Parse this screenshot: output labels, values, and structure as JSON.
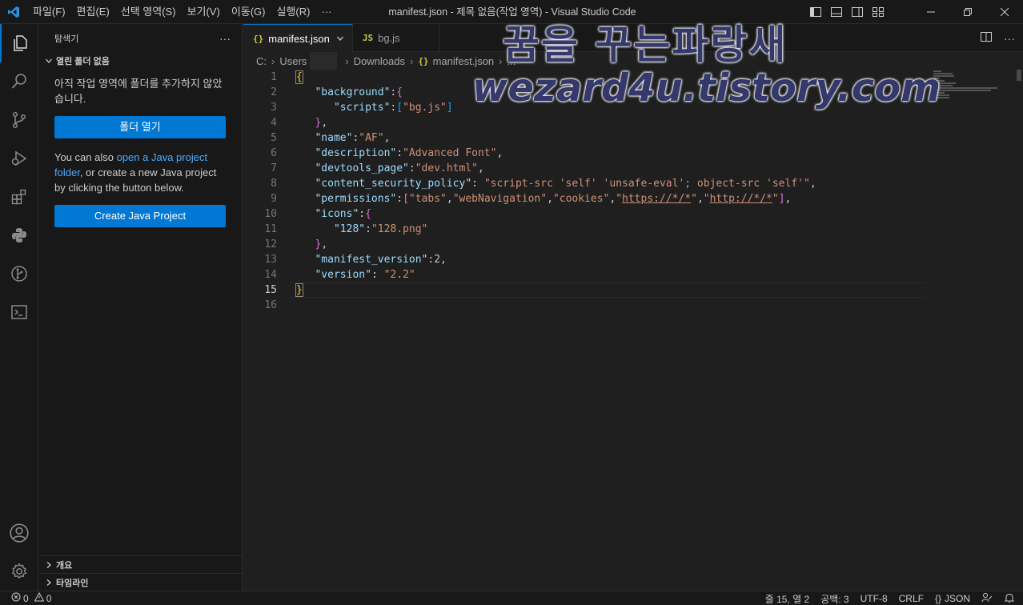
{
  "titlebar": {
    "menu": [
      "파일(F)",
      "편집(E)",
      "선택 영역(S)",
      "보기(V)",
      "이동(G)",
      "실행(R)",
      "···"
    ],
    "title": "manifest.json - 제목 없음(작업 영역) - Visual Studio Code"
  },
  "sidebar": {
    "header": "탐색기",
    "more": "···",
    "section": "열린 폴더 없음",
    "message": "아직 작업 영역에 폴더를 추가하지 않았습니다.",
    "open_folder": "폴더 열기",
    "java_pre": "You can also ",
    "java_link": "open a Java project folder",
    "java_post": ", or create a new Java project by clicking the button below.",
    "create_java": "Create Java Project",
    "outline": "개요",
    "timeline": "타임라인"
  },
  "tabs": [
    {
      "icon": "{}",
      "label": "manifest.json",
      "active": true
    },
    {
      "icon": "JS",
      "label": "bg.js",
      "active": false
    }
  ],
  "breadcrumb": {
    "drive": "C:",
    "users": "Users",
    "downloads": "Downloads",
    "file": "manifest.json",
    "ellipsis": "..."
  },
  "code": {
    "line_numbers": [
      "1",
      "2",
      "3",
      "4",
      "5",
      "6",
      "7",
      "8",
      "9",
      "10",
      "11",
      "12",
      "13",
      "14",
      "15",
      "16"
    ],
    "current_line": 15
  },
  "watermark": {
    "line1": "꿈을 꾸는파랑새",
    "line2": "wezard4u.tistory.com"
  },
  "statusbar": {
    "errors": "0",
    "warnings": "0",
    "position": "줄 15, 열 2",
    "spaces": "공백: 3",
    "encoding": "UTF-8",
    "eol": "CRLF",
    "language": "JSON"
  },
  "colors": {
    "accent": "#0078d4",
    "json_key": "#9cdcfe",
    "json_string": "#ce9178",
    "json_number": "#b5cea8",
    "bracket_level1": "#ffd700",
    "bracket_level2": "#da70d6",
    "bracket_level3": "#179fff"
  }
}
